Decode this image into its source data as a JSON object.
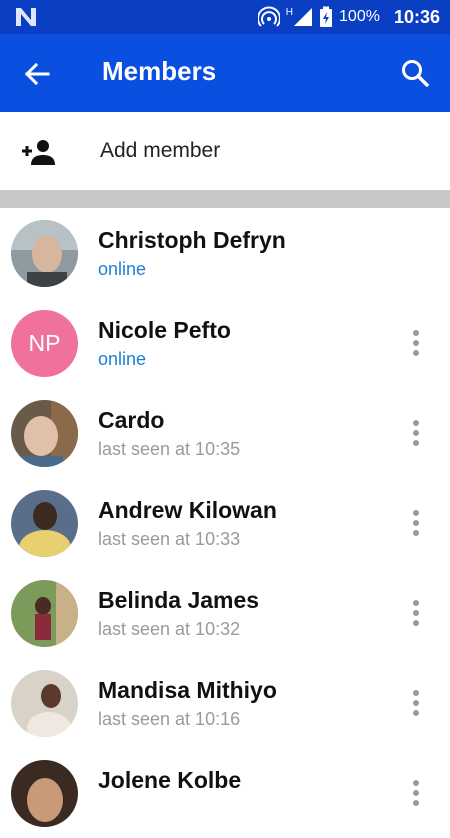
{
  "status_bar": {
    "battery": "100%",
    "time": "10:36",
    "network_type": "H"
  },
  "app_bar": {
    "title": "Members"
  },
  "add_member": {
    "label": "Add member"
  },
  "members": [
    {
      "name": "Christoph Defryn",
      "status": "online",
      "avatar": "photo"
    },
    {
      "name": "Nicole Pefto",
      "status": "online",
      "initials": "NP",
      "avatar_color": "#f0719a"
    },
    {
      "name": "Cardo",
      "status": "last seen at 10:35",
      "avatar": "photo"
    },
    {
      "name": "Andrew Kilowan",
      "status": "last seen at 10:33",
      "avatar": "photo"
    },
    {
      "name": "Belinda James",
      "status": "last seen at 10:32",
      "avatar": "photo"
    },
    {
      "name": "Mandisa Mithiyo",
      "status": "last seen at 10:16",
      "avatar": "photo"
    },
    {
      "name": "Jolene Kolbe",
      "status": "",
      "avatar": "photo"
    }
  ],
  "colors": {
    "status_bar": "#0a3fc4",
    "app_bar": "#0a4fe0",
    "online": "#1e7fd8",
    "secondary_text": "#9a9a9a"
  }
}
